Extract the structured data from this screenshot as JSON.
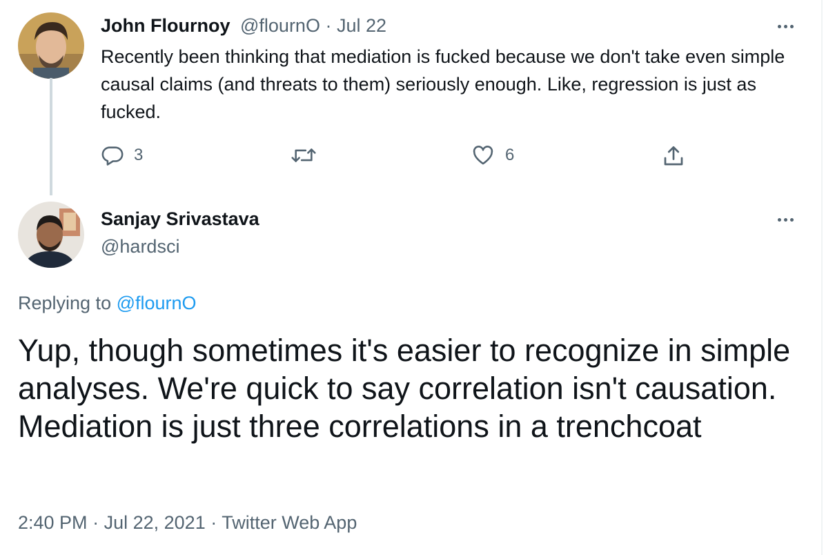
{
  "tweet1": {
    "author_name": "John Flournoy",
    "handle": "@flournO",
    "separator": "·",
    "date": "Jul 22",
    "text": "Recently been thinking that mediation is fucked because we don't take even simple causal claims (and threats to them) seriously enough. Like, regression is just as fucked.",
    "actions": {
      "reply": {
        "icon": "reply-icon",
        "count": "3"
      },
      "retweet": {
        "icon": "retweet-icon",
        "count": ""
      },
      "like": {
        "icon": "heart-icon",
        "count": "6"
      },
      "share": {
        "icon": "share-icon"
      }
    }
  },
  "tweet2": {
    "author_name": "Sanjay Srivastava",
    "handle": "@hardsci",
    "replying_prefix": "Replying to",
    "replying_to": "@flournO",
    "text": "Yup, though sometimes it's easier to recognize in simple analyses. We're quick to say correlation isn't causation. Mediation is just three correlations in a trenchcoat",
    "timestamp": "2:40 PM",
    "date": "Jul 22, 2021",
    "source": "Twitter Web App",
    "separator": "·"
  },
  "colors": {
    "text": "#0f1419",
    "muted": "#536471",
    "link": "#1d9bf0",
    "thread_line": "#cfd9de"
  }
}
